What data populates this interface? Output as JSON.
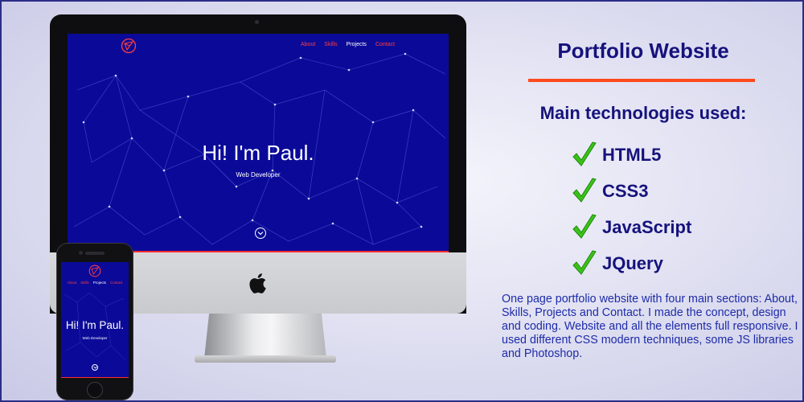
{
  "mockup": {
    "desktop": {
      "nav": [
        {
          "label": "About",
          "active": false
        },
        {
          "label": "Skills",
          "active": false
        },
        {
          "label": "Projects",
          "active": true
        },
        {
          "label": "Contact",
          "active": false
        }
      ],
      "hero_title": "Hi! I'm Paul.",
      "hero_subtitle": "Web Developer",
      "scroll_icon": "chevron-down-circle-icon",
      "brand_icon": "logo-mark-icon",
      "device_icon": "apple-logo-icon"
    },
    "mobile": {
      "nav": [
        {
          "label": "About",
          "active": false
        },
        {
          "label": "Skills",
          "active": false
        },
        {
          "label": "Projects",
          "active": true
        },
        {
          "label": "Contact",
          "active": false
        }
      ],
      "hero_title": "Hi! I'm Paul.",
      "hero_subtitle": "Web Developer",
      "scroll_icon": "chevron-down-circle-icon"
    }
  },
  "panel": {
    "title": "Portfolio Website",
    "subtitle": "Main technologies used:",
    "technologies": [
      "HTML5",
      "CSS3",
      "JavaScript",
      "JQuery"
    ],
    "check_icon": "check-mark-icon",
    "description": "One page portfolio website with four main sections: About, Skills, Projects and Contact. I made the concept, design and coding. Website and all the elements full responsive. I used different CSS modern techniques, some JS libraries and Photoshop."
  },
  "colors": {
    "site_background": "#0b0a98",
    "accent_red": "#ff3e3e",
    "heading_navy": "#16127c",
    "rule_orange": "#ff4a1c",
    "check_green": "#3cc21a",
    "description_blue": "#1d2ba8"
  }
}
